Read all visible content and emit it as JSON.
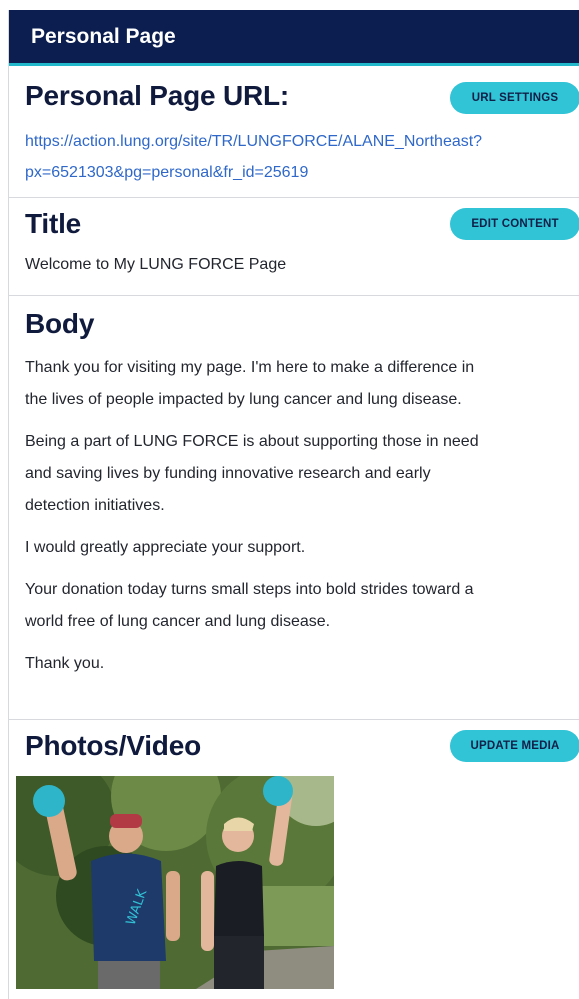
{
  "header": {
    "title": "Personal Page"
  },
  "url_section": {
    "title": "Personal Page URL:",
    "button": "URL SETTINGS",
    "url_line1": "https://action.lung.org/site/TR/LUNGFORCE/ALANE_Northeast?",
    "url_line2": "px=6521303&pg=personal&fr_id=25619"
  },
  "title_section": {
    "title": "Title",
    "button": "EDIT CONTENT",
    "value": "Welcome to My LUNG FORCE Page"
  },
  "body_section": {
    "title": "Body",
    "paragraphs": [
      {
        "lines": [
          "Thank you for visiting my page. I'm here to make a difference in",
          "the lives of people impacted by lung cancer and lung disease."
        ]
      },
      {
        "lines": [
          "Being a part of LUNG FORCE is about supporting those in need",
          "and saving lives by funding innovative research and early",
          "detection initiatives."
        ]
      },
      {
        "lines": [
          "I would greatly appreciate your support."
        ]
      },
      {
        "lines": [
          "Your donation today turns small steps into bold strides toward a",
          "world free of lung cancer and lung disease."
        ]
      },
      {
        "lines": [
          "Thank you."
        ]
      }
    ]
  },
  "media_section": {
    "title": "Photos/Video",
    "button": "UPDATE MEDIA",
    "shirt_text": "WALK"
  },
  "colors": {
    "navy": "#0b1e4f",
    "teal": "#31c3d6",
    "link": "#2f68c9"
  }
}
